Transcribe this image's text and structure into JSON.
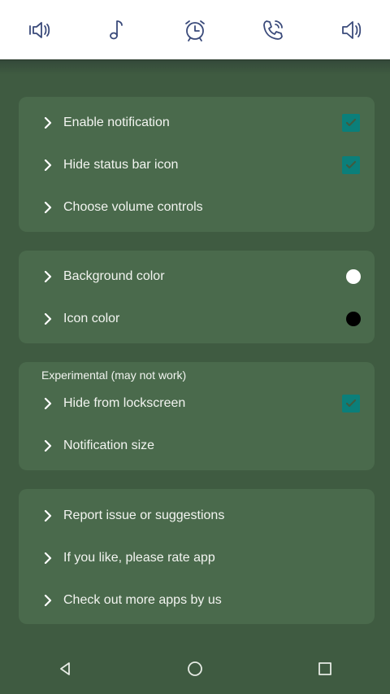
{
  "toolbar": {
    "icons": [
      "speaker-vibrate-icon",
      "music-note-icon",
      "alarm-clock-icon",
      "phone-ringing-icon",
      "speaker-volume-icon"
    ]
  },
  "colors": {
    "background": "#3f5b41",
    "card": "#4a6a4c",
    "checkbox": "#0b7f7a",
    "bg_color_value": "#ffffff",
    "icon_color_value": "#000000"
  },
  "settings": {
    "enable_notification": {
      "label": "Enable notification",
      "checked": true
    },
    "hide_status_bar_icon": {
      "label": "Hide status bar icon",
      "checked": true
    },
    "choose_volume_controls": {
      "label": "Choose volume controls"
    },
    "background_color": {
      "label": "Background color"
    },
    "icon_color": {
      "label": "Icon color"
    },
    "experimental_header": "Experimental (may not work)",
    "hide_from_lockscreen": {
      "label": "Hide from lockscreen",
      "checked": true
    },
    "notification_size": {
      "label": "Notification size"
    },
    "report_issue": {
      "label": "Report issue or suggestions"
    },
    "rate_app": {
      "label": "If you like, please rate app"
    },
    "more_apps": {
      "label": "Check out more apps by us"
    }
  }
}
